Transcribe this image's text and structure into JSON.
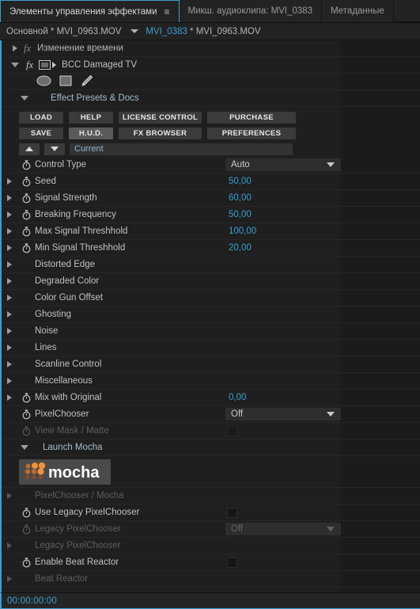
{
  "window": {
    "timecode": "00:00:00:00",
    "accent_color": "#3a9fd0"
  },
  "tabs": [
    {
      "label": "Элементы управления эффектами",
      "active": true,
      "menu_icon": "≡"
    },
    {
      "label": "Микш. аудиоклипа: MVI_0383",
      "active": false
    },
    {
      "label": "Метаданные",
      "active": false
    }
  ],
  "breadcrumb": {
    "sequence": "Основной * MVI_0963.MOV",
    "clip_highlight": "MVI_0383",
    "clip_rest": " * MVI_0963.MOV"
  },
  "effects": {
    "time_remap": {
      "label": "Изменение времени",
      "fx": "fx"
    },
    "bcc": {
      "label": "BCC Damaged TV",
      "fx": "fx"
    }
  },
  "mask_tools": [
    {
      "name": "ellipse-mask-tool"
    },
    {
      "name": "rectangle-mask-tool"
    },
    {
      "name": "pen-mask-tool"
    }
  ],
  "presets": {
    "heading": "Effect Presets & Docs",
    "buttons_row1": [
      {
        "label": "LOAD",
        "width_class": "w-load",
        "active": false
      },
      {
        "label": "HELP",
        "width_class": "w-help",
        "active": false
      },
      {
        "label": "LICENSE CONTROL",
        "width_class": "w-lic",
        "active": false
      },
      {
        "label": "PURCHASE",
        "width_class": "w-pur",
        "active": false
      }
    ],
    "buttons_row2": [
      {
        "label": "SAVE",
        "width_class": "w-load",
        "active": false
      },
      {
        "label": "H.U.D.",
        "width_class": "w-help",
        "active": true
      },
      {
        "label": "FX BROWSER",
        "width_class": "w-lic",
        "active": false
      },
      {
        "label": "PREFERENCES",
        "width_class": "w-pur",
        "active": false
      }
    ],
    "nav_prev": "▲",
    "nav_next": "▼",
    "current_preset": "Current"
  },
  "parameters": [
    {
      "name": "control-type",
      "label": "Control Type",
      "type": "dropdown",
      "value": "Auto",
      "stopwatch": true,
      "expand": false,
      "dim": false
    },
    {
      "name": "seed",
      "label": "Seed",
      "type": "value",
      "value": "50,00",
      "stopwatch": true,
      "expand": true,
      "dim": false
    },
    {
      "name": "signal-strength",
      "label": "Signal Strength",
      "type": "value",
      "value": "60,00",
      "stopwatch": true,
      "expand": true,
      "dim": false
    },
    {
      "name": "breaking-frequency",
      "label": "Breaking Frequency",
      "type": "value",
      "value": "50,00",
      "stopwatch": true,
      "expand": true,
      "dim": false
    },
    {
      "name": "max-signal-threshold",
      "label": "Max Signal Threshhold",
      "type": "value",
      "value": "100,00",
      "stopwatch": true,
      "expand": true,
      "dim": false
    },
    {
      "name": "min-signal-threshold",
      "label": "Min Signal Threshhold",
      "type": "value",
      "value": "20,00",
      "stopwatch": true,
      "expand": true,
      "dim": false
    },
    {
      "name": "distorted-edge",
      "label": "Distorted Edge",
      "type": "group",
      "value": "",
      "stopwatch": false,
      "expand": true,
      "dim": false
    },
    {
      "name": "degraded-color",
      "label": "Degraded Color",
      "type": "group",
      "value": "",
      "stopwatch": false,
      "expand": true,
      "dim": false
    },
    {
      "name": "color-gun-offset",
      "label": "Color Gun Offset",
      "type": "group",
      "value": "",
      "stopwatch": false,
      "expand": true,
      "dim": false
    },
    {
      "name": "ghosting",
      "label": "Ghosting",
      "type": "group",
      "value": "",
      "stopwatch": false,
      "expand": true,
      "dim": false
    },
    {
      "name": "noise",
      "label": "Noise",
      "type": "group",
      "value": "",
      "stopwatch": false,
      "expand": true,
      "dim": false
    },
    {
      "name": "lines",
      "label": "Lines",
      "type": "group",
      "value": "",
      "stopwatch": false,
      "expand": true,
      "dim": false
    },
    {
      "name": "scanline-control",
      "label": "Scanline Control",
      "type": "group",
      "value": "",
      "stopwatch": false,
      "expand": true,
      "dim": false
    },
    {
      "name": "miscellaneous",
      "label": "Miscellaneous",
      "type": "group",
      "value": "",
      "stopwatch": false,
      "expand": true,
      "dim": false
    },
    {
      "name": "mix-with-original",
      "label": "Mix with Original",
      "type": "value",
      "value": "0,00",
      "stopwatch": true,
      "expand": true,
      "dim": false
    },
    {
      "name": "pixelchooser",
      "label": "PixelChooser",
      "type": "dropdown",
      "value": "Off",
      "stopwatch": true,
      "expand": false,
      "dim": false
    },
    {
      "name": "view-mask-matte",
      "label": "View Mask / Matte",
      "type": "checkbox",
      "value": "",
      "stopwatch": true,
      "expand": false,
      "dim": true
    }
  ],
  "mocha": {
    "heading": "Launch Mocha",
    "logo_text": "mocha",
    "logo_bg": "#4a4a4a",
    "dot_colors": [
      "#f0903a",
      "#c06a30",
      "#8a4e28"
    ]
  },
  "parameters_bottom": [
    {
      "name": "pixelchooser-mocha",
      "label": "PixelChooser / Mocha",
      "type": "group",
      "value": "",
      "stopwatch": false,
      "expand": true,
      "dim": true
    },
    {
      "name": "use-legacy-pixelchooser",
      "label": "Use Legacy PixelChooser",
      "type": "checkbox",
      "value": "",
      "stopwatch": true,
      "expand": false,
      "dim": false
    },
    {
      "name": "legacy-pixelchooser-dd",
      "label": "Legacy PixelChooser",
      "type": "dropdown",
      "value": "Off",
      "stopwatch": true,
      "expand": false,
      "dim": true
    },
    {
      "name": "legacy-pixelchooser-grp",
      "label": "Legacy PixelChooser",
      "type": "group",
      "value": "",
      "stopwatch": false,
      "expand": true,
      "dim": true
    },
    {
      "name": "enable-beat-reactor",
      "label": "Enable Beat Reactor",
      "type": "checkbox",
      "value": "",
      "stopwatch": true,
      "expand": false,
      "dim": false
    },
    {
      "name": "beat-reactor",
      "label": "Beat Reactor",
      "type": "group",
      "value": "",
      "stopwatch": false,
      "expand": true,
      "dim": true
    }
  ]
}
